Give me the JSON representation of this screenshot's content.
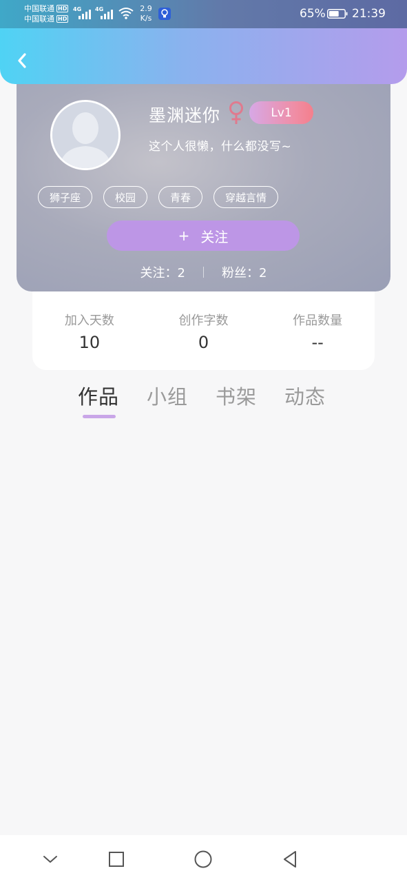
{
  "status_bar": {
    "carrier1": "中国联通",
    "carrier2": "中国联通",
    "hd": "HD",
    "network_tag1": "4G",
    "network_tag2": "4G",
    "speed_value": "2.9",
    "speed_unit": "K/s",
    "battery_percent": "65%",
    "battery_level": 0.65,
    "time": "21:39"
  },
  "icons": {
    "back": "chevron-left-icon",
    "gender": "female-icon",
    "wifi": "wifi-icon",
    "bulb": "lightbulb-icon",
    "battery": "battery-icon",
    "nav_down": "chevron-down-icon",
    "nav_recent": "square-icon",
    "nav_home": "circle-icon",
    "nav_back": "triangle-back-icon"
  },
  "profile": {
    "username": "墨渊迷你",
    "level": "Lv1",
    "bio": "这个人很懒，什么都没写~",
    "tags": [
      "狮子座",
      "校园",
      "青春",
      "穿越言情"
    ],
    "follow_plus": "+",
    "follow_label": "关注",
    "following_text": "关注：2",
    "followers_text": "粉丝：2"
  },
  "stats": [
    {
      "label": "加入天数",
      "value": "10"
    },
    {
      "label": "创作字数",
      "value": "0"
    },
    {
      "label": "作品数量",
      "value": "--"
    }
  ],
  "tabs": [
    {
      "label": "作品",
      "active": true
    },
    {
      "label": "小组",
      "active": false
    },
    {
      "label": "书架",
      "active": false
    },
    {
      "label": "动态",
      "active": false
    }
  ],
  "colors": {
    "header_gradient_start": "#4fd3f4",
    "header_gradient_end": "#b49cec",
    "follow_button": "#bd96e6",
    "gender_icon": "#e07a8e",
    "tab_indicator": "#c9a6e8",
    "level_badge_start": "#d7a8e6",
    "level_badge_end": "#f47f8c"
  }
}
